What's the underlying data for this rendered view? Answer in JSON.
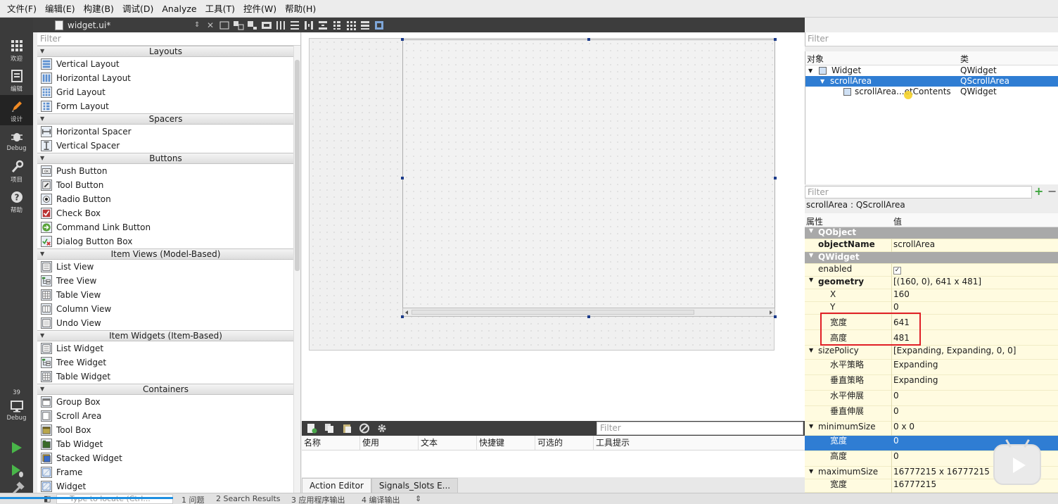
{
  "menu": [
    "文件(F)",
    "编辑(E)",
    "构建(B)",
    "调试(D)",
    "Analyze",
    "工具(T)",
    "控件(W)",
    "帮助(H)"
  ],
  "modes": [
    {
      "label": "欢迎",
      "icon": "grid-icon"
    },
    {
      "label": "编辑",
      "icon": "edit-icon"
    },
    {
      "label": "设计",
      "icon": "pencil-icon"
    },
    {
      "label": "Debug",
      "icon": "bug-icon"
    },
    {
      "label": "项目",
      "icon": "wrench-icon"
    },
    {
      "label": "帮助",
      "icon": "help-icon"
    }
  ],
  "kit": {
    "number": "39",
    "label": "Debug"
  },
  "file_tab": {
    "name": "widget.ui*"
  },
  "widget_box": {
    "filter_placeholder": "Filter",
    "categories": [
      {
        "name": "Layouts",
        "items": [
          "Vertical Layout",
          "Horizontal Layout",
          "Grid Layout",
          "Form Layout"
        ]
      },
      {
        "name": "Spacers",
        "items": [
          "Horizontal Spacer",
          "Vertical Spacer"
        ]
      },
      {
        "name": "Buttons",
        "items": [
          "Push Button",
          "Tool Button",
          "Radio Button",
          "Check Box",
          "Command Link Button",
          "Dialog Button Box"
        ]
      },
      {
        "name": "Item Views (Model-Based)",
        "items": [
          "List View",
          "Tree View",
          "Table View",
          "Column View",
          "Undo View"
        ]
      },
      {
        "name": "Item Widgets (Item-Based)",
        "items": [
          "List Widget",
          "Tree Widget",
          "Table Widget"
        ]
      },
      {
        "name": "Containers",
        "items": [
          "Group Box",
          "Scroll Area",
          "Tool Box",
          "Tab Widget",
          "Stacked Widget",
          "Frame",
          "Widget"
        ]
      }
    ]
  },
  "action_editor": {
    "filter_placeholder": "Filter",
    "columns": [
      "名称",
      "使用",
      "文本",
      "快捷键",
      "可选的",
      "工具提示"
    ],
    "tabs": [
      "Action Editor",
      "Signals_Slots E..."
    ]
  },
  "object_inspector": {
    "filter_placeholder": "Filter",
    "col_object": "对象",
    "col_class": "类",
    "rows": [
      {
        "name": "Widget",
        "class": "QWidget"
      },
      {
        "name": "scrollArea",
        "class": "QScrollArea"
      },
      {
        "name": "scrollArea...etContents",
        "class": "QWidget"
      }
    ]
  },
  "property_editor": {
    "filter_placeholder": "Filter",
    "object_class": "scrollArea : QScrollArea",
    "col_property": "属性",
    "col_value": "值",
    "rows": [
      {
        "name": "QObject",
        "value": ""
      },
      {
        "name": "objectName",
        "value": "scrollArea"
      },
      {
        "name": "QWidget",
        "value": ""
      },
      {
        "name": "enabled",
        "value": "✓"
      },
      {
        "name": "geometry",
        "value": "[(160, 0), 641 x 481]"
      },
      {
        "name": "X",
        "value": "160"
      },
      {
        "name": "Y",
        "value": "0"
      },
      {
        "name": "宽度",
        "value": "641"
      },
      {
        "name": "高度",
        "value": "481"
      },
      {
        "name": "sizePolicy",
        "value": "[Expanding, Expanding, 0, 0]"
      },
      {
        "name": "水平策略",
        "value": "Expanding"
      },
      {
        "name": "垂直策略",
        "value": "Expanding"
      },
      {
        "name": "水平伸展",
        "value": "0"
      },
      {
        "name": "垂直伸展",
        "value": "0"
      },
      {
        "name": "minimumSize",
        "value": "0 x 0"
      },
      {
        "name": "宽度",
        "value": "0"
      },
      {
        "name": "高度",
        "value": "0"
      },
      {
        "name": "maximumSize",
        "value": "16777215 x 16777215"
      },
      {
        "name": "宽度",
        "value": "16777215"
      }
    ]
  },
  "statusbar": {
    "locator_placeholder": "Type to locate (Ctrl...",
    "items": [
      "1 问题",
      "2 Search Results",
      "3 应用程序输出",
      "4 编译输出"
    ]
  },
  "colors": {
    "accent": "#2f7dd3",
    "highlight_box": "#e01f26",
    "property_bg": "#fffbe0"
  }
}
